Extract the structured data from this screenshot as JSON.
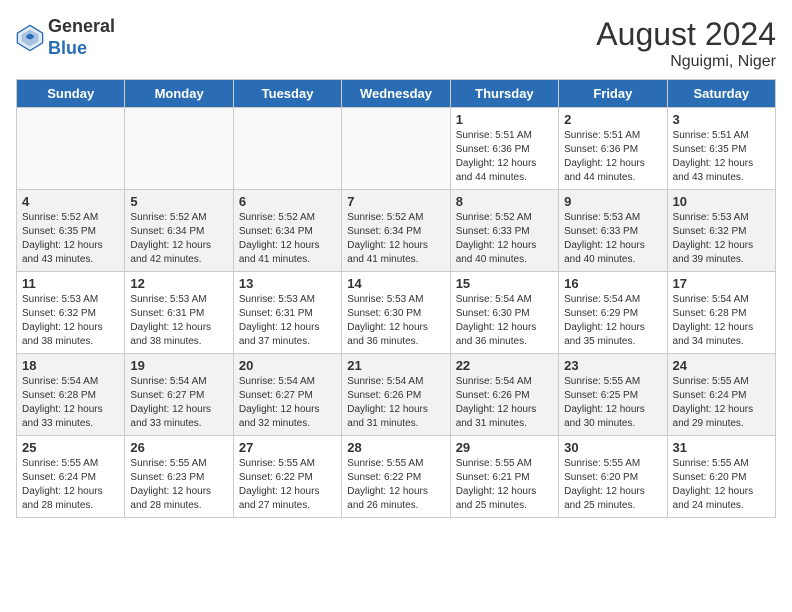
{
  "header": {
    "logo_general": "General",
    "logo_blue": "Blue",
    "month_year": "August 2024",
    "location": "Nguigmi, Niger"
  },
  "days_of_week": [
    "Sunday",
    "Monday",
    "Tuesday",
    "Wednesday",
    "Thursday",
    "Friday",
    "Saturday"
  ],
  "weeks": [
    [
      {
        "day": "",
        "info": ""
      },
      {
        "day": "",
        "info": ""
      },
      {
        "day": "",
        "info": ""
      },
      {
        "day": "",
        "info": ""
      },
      {
        "day": "1",
        "info": "Sunrise: 5:51 AM\nSunset: 6:36 PM\nDaylight: 12 hours\nand 44 minutes."
      },
      {
        "day": "2",
        "info": "Sunrise: 5:51 AM\nSunset: 6:36 PM\nDaylight: 12 hours\nand 44 minutes."
      },
      {
        "day": "3",
        "info": "Sunrise: 5:51 AM\nSunset: 6:35 PM\nDaylight: 12 hours\nand 43 minutes."
      }
    ],
    [
      {
        "day": "4",
        "info": "Sunrise: 5:52 AM\nSunset: 6:35 PM\nDaylight: 12 hours\nand 43 minutes."
      },
      {
        "day": "5",
        "info": "Sunrise: 5:52 AM\nSunset: 6:34 PM\nDaylight: 12 hours\nand 42 minutes."
      },
      {
        "day": "6",
        "info": "Sunrise: 5:52 AM\nSunset: 6:34 PM\nDaylight: 12 hours\nand 41 minutes."
      },
      {
        "day": "7",
        "info": "Sunrise: 5:52 AM\nSunset: 6:34 PM\nDaylight: 12 hours\nand 41 minutes."
      },
      {
        "day": "8",
        "info": "Sunrise: 5:52 AM\nSunset: 6:33 PM\nDaylight: 12 hours\nand 40 minutes."
      },
      {
        "day": "9",
        "info": "Sunrise: 5:53 AM\nSunset: 6:33 PM\nDaylight: 12 hours\nand 40 minutes."
      },
      {
        "day": "10",
        "info": "Sunrise: 5:53 AM\nSunset: 6:32 PM\nDaylight: 12 hours\nand 39 minutes."
      }
    ],
    [
      {
        "day": "11",
        "info": "Sunrise: 5:53 AM\nSunset: 6:32 PM\nDaylight: 12 hours\nand 38 minutes."
      },
      {
        "day": "12",
        "info": "Sunrise: 5:53 AM\nSunset: 6:31 PM\nDaylight: 12 hours\nand 38 minutes."
      },
      {
        "day": "13",
        "info": "Sunrise: 5:53 AM\nSunset: 6:31 PM\nDaylight: 12 hours\nand 37 minutes."
      },
      {
        "day": "14",
        "info": "Sunrise: 5:53 AM\nSunset: 6:30 PM\nDaylight: 12 hours\nand 36 minutes."
      },
      {
        "day": "15",
        "info": "Sunrise: 5:54 AM\nSunset: 6:30 PM\nDaylight: 12 hours\nand 36 minutes."
      },
      {
        "day": "16",
        "info": "Sunrise: 5:54 AM\nSunset: 6:29 PM\nDaylight: 12 hours\nand 35 minutes."
      },
      {
        "day": "17",
        "info": "Sunrise: 5:54 AM\nSunset: 6:28 PM\nDaylight: 12 hours\nand 34 minutes."
      }
    ],
    [
      {
        "day": "18",
        "info": "Sunrise: 5:54 AM\nSunset: 6:28 PM\nDaylight: 12 hours\nand 33 minutes."
      },
      {
        "day": "19",
        "info": "Sunrise: 5:54 AM\nSunset: 6:27 PM\nDaylight: 12 hours\nand 33 minutes."
      },
      {
        "day": "20",
        "info": "Sunrise: 5:54 AM\nSunset: 6:27 PM\nDaylight: 12 hours\nand 32 minutes."
      },
      {
        "day": "21",
        "info": "Sunrise: 5:54 AM\nSunset: 6:26 PM\nDaylight: 12 hours\nand 31 minutes."
      },
      {
        "day": "22",
        "info": "Sunrise: 5:54 AM\nSunset: 6:26 PM\nDaylight: 12 hours\nand 31 minutes."
      },
      {
        "day": "23",
        "info": "Sunrise: 5:55 AM\nSunset: 6:25 PM\nDaylight: 12 hours\nand 30 minutes."
      },
      {
        "day": "24",
        "info": "Sunrise: 5:55 AM\nSunset: 6:24 PM\nDaylight: 12 hours\nand 29 minutes."
      }
    ],
    [
      {
        "day": "25",
        "info": "Sunrise: 5:55 AM\nSunset: 6:24 PM\nDaylight: 12 hours\nand 28 minutes."
      },
      {
        "day": "26",
        "info": "Sunrise: 5:55 AM\nSunset: 6:23 PM\nDaylight: 12 hours\nand 28 minutes."
      },
      {
        "day": "27",
        "info": "Sunrise: 5:55 AM\nSunset: 6:22 PM\nDaylight: 12 hours\nand 27 minutes."
      },
      {
        "day": "28",
        "info": "Sunrise: 5:55 AM\nSunset: 6:22 PM\nDaylight: 12 hours\nand 26 minutes."
      },
      {
        "day": "29",
        "info": "Sunrise: 5:55 AM\nSunset: 6:21 PM\nDaylight: 12 hours\nand 25 minutes."
      },
      {
        "day": "30",
        "info": "Sunrise: 5:55 AM\nSunset: 6:20 PM\nDaylight: 12 hours\nand 25 minutes."
      },
      {
        "day": "31",
        "info": "Sunrise: 5:55 AM\nSunset: 6:20 PM\nDaylight: 12 hours\nand 24 minutes."
      }
    ]
  ]
}
